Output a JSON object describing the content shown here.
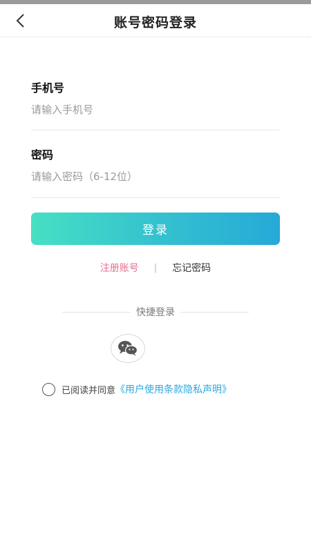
{
  "header": {
    "title": "账号密码登录",
    "back_icon": "chevron-left-icon"
  },
  "form": {
    "phone": {
      "label": "手机号",
      "placeholder": "请输入手机号",
      "value": ""
    },
    "password": {
      "label": "密码",
      "placeholder": "请输入密码（6-12位）",
      "value": ""
    },
    "login_button": "登录"
  },
  "links": {
    "register": "注册账号",
    "separator": "|",
    "forgot": "忘记密码"
  },
  "quick_login": {
    "label": "快捷登录",
    "icon": "wechat-icon"
  },
  "agreement": {
    "checked": false,
    "prefix": "已阅读并同意",
    "link": "《用户使用条款隐私声明》"
  },
  "colors": {
    "button_gradient_start": "#46e0c3",
    "button_gradient_end": "#26a9d8",
    "register_link": "#e56f8e",
    "agreement_link": "#2aa8e0"
  }
}
